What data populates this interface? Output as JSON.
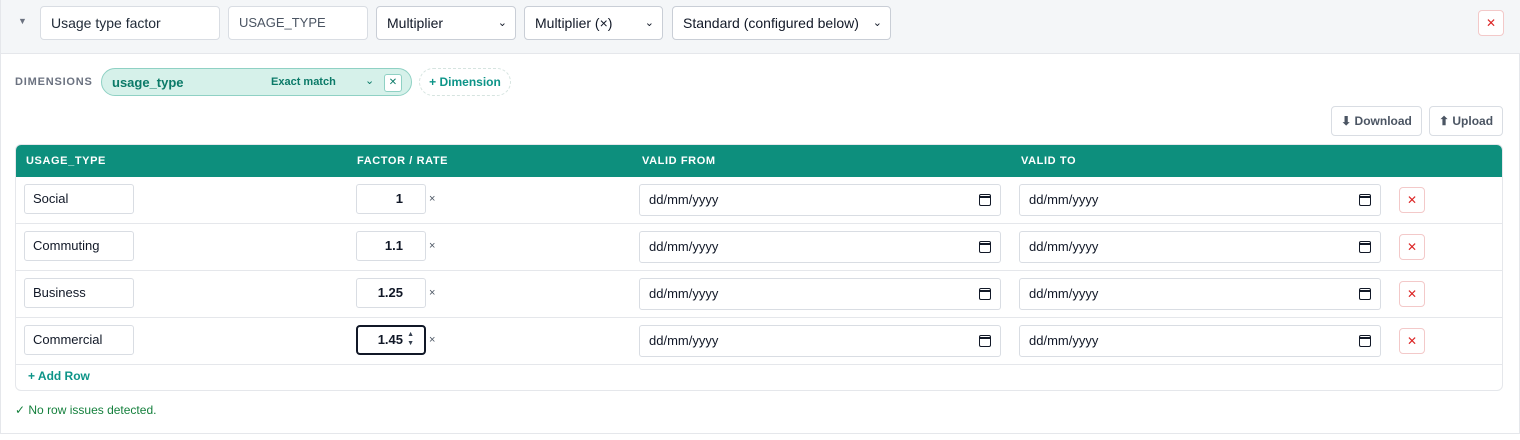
{
  "header": {
    "name_value": "Usage type factor",
    "key_value": "USAGE_TYPE",
    "type_select": "Multiplier",
    "mode_select": "Multiplier (×)",
    "config_select": "Standard (configured below)"
  },
  "dimensions": {
    "label": "DIMENSIONS",
    "items": [
      {
        "name": "usage_type",
        "match": "Exact match"
      }
    ],
    "add_label": "+ Dimension"
  },
  "toolbar": {
    "download_label": "⬇ Download",
    "upload_label": "⬆ Upload"
  },
  "table": {
    "columns": [
      "USAGE_TYPE",
      "FACTOR / RATE",
      "VALID FROM",
      "VALID TO"
    ],
    "rows": [
      {
        "usage_type": "Social",
        "factor": "1",
        "valid_from": "dd/mm/yyyy",
        "valid_to": "dd/mm/yyyy"
      },
      {
        "usage_type": "Commuting",
        "factor": "1.1",
        "valid_from": "dd/mm/yyyy",
        "valid_to": "dd/mm/yyyy"
      },
      {
        "usage_type": "Business",
        "factor": "1.25",
        "valid_from": "dd/mm/yyyy",
        "valid_to": "dd/mm/yyyy"
      },
      {
        "usage_type": "Commercial",
        "factor": "1.45",
        "valid_from": "dd/mm/yyyy",
        "valid_to": "dd/mm/yyyy"
      }
    ],
    "multiplier_symbol": "×",
    "add_row_label": "+ Add Row"
  },
  "status": {
    "text": "✓ No row issues detected."
  },
  "icons": {
    "collapse": "triangle-down-icon",
    "remove": "close-icon",
    "calendar": "calendar-icon"
  },
  "colors": {
    "accent": "#0d8f7d",
    "danger": "#dc2626",
    "success": "#15803d"
  }
}
